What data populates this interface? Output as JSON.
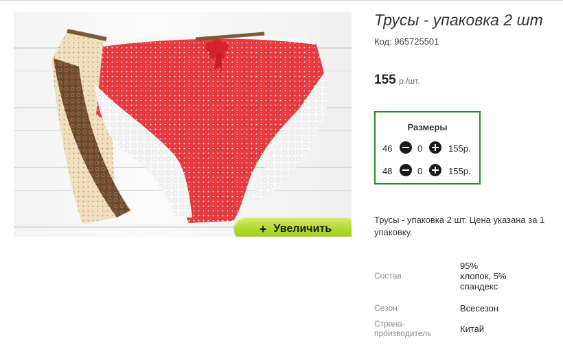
{
  "product": {
    "title": "Трусы - упаковка 2 шт",
    "code": "Код: 965725501",
    "price_amount": "155",
    "price_unit": "р./шт.",
    "zoom_label": "Увеличить",
    "zoom_icon": "plus-icon",
    "description": "Трусы - упаковка 2 шт. Цена указана за 1 упаковку."
  },
  "sizes": {
    "title": "Размеры",
    "rows": [
      {
        "size": "46",
        "qty": "0",
        "price": "155р."
      },
      {
        "size": "48",
        "qty": "0",
        "price": "155р."
      }
    ]
  },
  "specs": [
    {
      "key": "Состав",
      "value": "95% хлопок, 5% спандекс"
    },
    {
      "key": "Сезон",
      "value": "Всесезон"
    },
    {
      "key": "Страна-производитель",
      "value": "Китай"
    }
  ],
  "colors": {
    "accent_border": "#2a8a2a",
    "zoom_button": "#a8d62a",
    "panties_red": "#e63b3f",
    "panties_beige": "#f1dfc0",
    "lace_brown": "#6f4a2f"
  }
}
